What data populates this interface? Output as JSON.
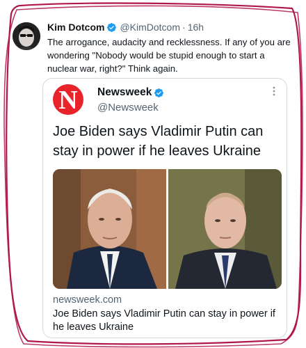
{
  "tweet": {
    "author_name": "Kim Dotcom",
    "author_handle": "@KimDotcom",
    "separator": "·",
    "timestamp": "16h",
    "text": "The arrogance, audacity and recklessness. If any of you are wondering \"Nobody would be stupid enough to start a nuclear war, right?\" Think again."
  },
  "quoted_tweet": {
    "author_name": "Newsweek",
    "author_handle": "@Newsweek",
    "logo_letter": "N",
    "text": "Joe Biden says Vladimir Putin can stay in power if he leaves Ukraine",
    "link_card": {
      "domain": "newsweek.com",
      "title": "Joe Biden says Vladimir Putin can stay in power if he leaves Ukraine"
    }
  },
  "colors": {
    "verified_badge": "#1d9bf0",
    "newsweek_red": "#e8232a",
    "hand_border": "#b0174a",
    "secondary_text": "#536471"
  },
  "icons": {
    "verified": "verified-badge-icon",
    "more": "more-options-icon"
  }
}
